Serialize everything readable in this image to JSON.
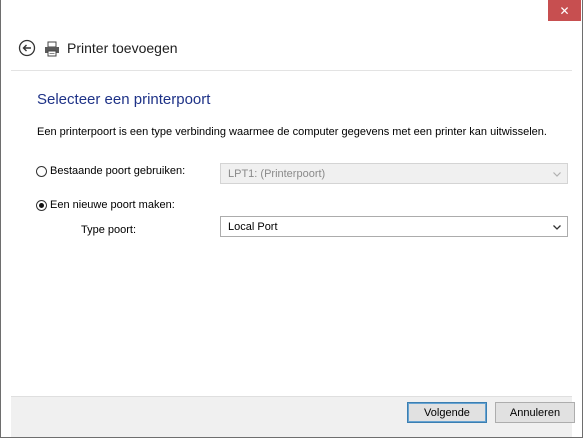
{
  "window": {
    "title": "Printer toevoegen",
    "close_label": "✕"
  },
  "page": {
    "heading": "Selecteer een printerpoort",
    "description": "Een printerpoort is een type verbinding waarmee de computer gegevens met een printer kan uitwisselen."
  },
  "options": {
    "existing_port": {
      "label": "Bestaande poort gebruiken:",
      "selected": false,
      "value": "LPT1: (Printerpoort)",
      "enabled": false
    },
    "new_port": {
      "label": "Een nieuwe poort maken:",
      "selected": true
    },
    "port_type": {
      "label": "Type poort:",
      "value": "Local Port"
    }
  },
  "buttons": {
    "next": "Volgende",
    "cancel": "Annuleren"
  },
  "colors": {
    "close_button": "#c74f50",
    "heading": "#1e3287",
    "footer": "#f0f0f0"
  },
  "icons": {
    "back": "back-arrow-icon",
    "printer": "printer-icon",
    "dropdown": "chevron-down-icon"
  }
}
